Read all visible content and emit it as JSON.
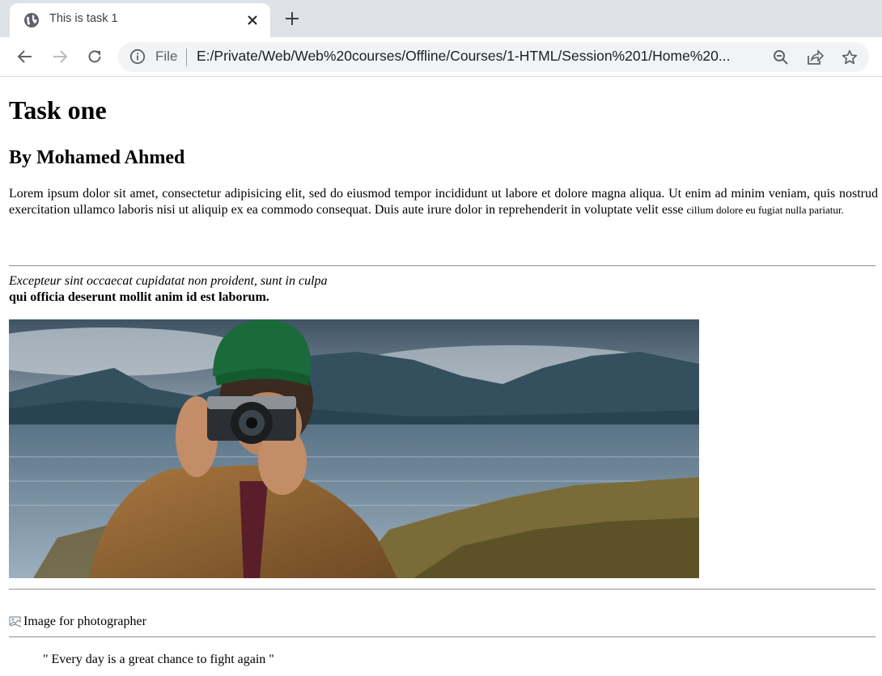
{
  "browser": {
    "tab_title": "This is task 1",
    "omnibox": {
      "scheme_label": "File",
      "url": "E:/Private/Web/Web%20courses/Offline/Courses/1-HTML/Session%201/Home%20..."
    },
    "icons": [
      "globe-icon",
      "close-icon",
      "plus-icon",
      "back-icon",
      "forward-icon",
      "reload-icon",
      "info-icon",
      "zoom-icon",
      "share-icon",
      "star-icon"
    ]
  },
  "page": {
    "heading": "Task one",
    "subheading": "By Mohamed Ahmed",
    "paragraph_main": "Lorem ipsum dolor sit amet, consectetur adipisicing elit, sed do eiusmod tempor incididunt ut labore et dolore magna aliqua. Ut enim ad minim veniam, quis nostrud exercitation ullamco laboris nisi ut aliquip ex ea commodo consequat. Duis aute irure dolor in reprehenderit in voluptate velit esse ",
    "paragraph_small": "cillum dolore eu fugiat nulla pariatur.",
    "italic_text": "Excepteur sint occaecat cupidatat non proident, sunt in culpa",
    "bold_text": "qui officia deserunt mollit anim id est laborum.",
    "broken_image_alt": "Image for photographer",
    "quote": "\" Every day is a great chance to fight again \""
  }
}
